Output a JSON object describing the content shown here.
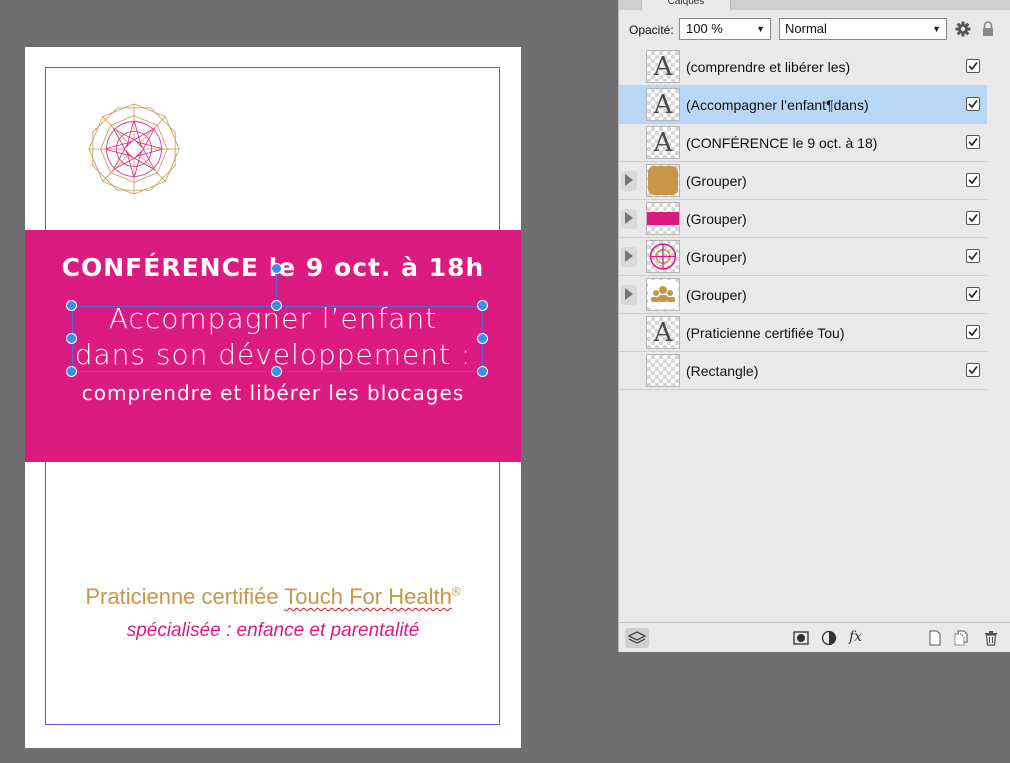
{
  "document": {
    "conference": "CONFÉRENCE le 9 oct. à 18h",
    "line1": "Accompagner l’enfant",
    "line2": "dans son développement :",
    "line3": "comprendre et libérer les blocages",
    "praticienne_prefix": "Praticienne certifiée ",
    "tfh": "Touch For Health",
    "reg": "®",
    "specialisee": "spécialisée : enfance et parentalité",
    "colors": {
      "pink": "#dc1b80",
      "gold": "#c8964a",
      "guide": "#5b5bd6"
    }
  },
  "panel": {
    "tab_label": "Calques",
    "opacity_label": "Opacité:",
    "opacity_value": "100 %",
    "blend_mode": "Normal",
    "layers": [
      {
        "name": "(comprendre et libérer les)",
        "thumb": "text-A",
        "expandable": false,
        "selected": false,
        "visible": true
      },
      {
        "name": "(Accompagner l’enfant¶dans)",
        "thumb": "text-A",
        "expandable": false,
        "selected": true,
        "visible": true
      },
      {
        "name": "(CONFÉRENCE le 9 oct. à 18)",
        "thumb": "text-A",
        "expandable": false,
        "selected": false,
        "visible": true
      },
      {
        "name": "(Grouper)",
        "thumb": "gold-rounded-rect",
        "expandable": true,
        "selected": false,
        "visible": true
      },
      {
        "name": "(Grouper)",
        "thumb": "pink-band",
        "expandable": true,
        "selected": false,
        "visible": true
      },
      {
        "name": "(Grouper)",
        "thumb": "mandala",
        "expandable": true,
        "selected": false,
        "visible": true
      },
      {
        "name": "(Grouper)",
        "thumb": "people-icon",
        "expandable": true,
        "selected": false,
        "visible": true
      },
      {
        "name": "(Praticienne certifiée Tou)",
        "thumb": "text-A",
        "expandable": false,
        "selected": false,
        "visible": true
      },
      {
        "name": "(Rectangle)",
        "thumb": "empty",
        "expandable": false,
        "selected": false,
        "visible": true
      }
    ],
    "footer_icons": [
      "layers-icon",
      "mask-icon",
      "adjustment-icon",
      "fx-icon",
      "new-layer-icon",
      "duplicate-icon",
      "trash-icon"
    ],
    "fx_label": "fx"
  }
}
